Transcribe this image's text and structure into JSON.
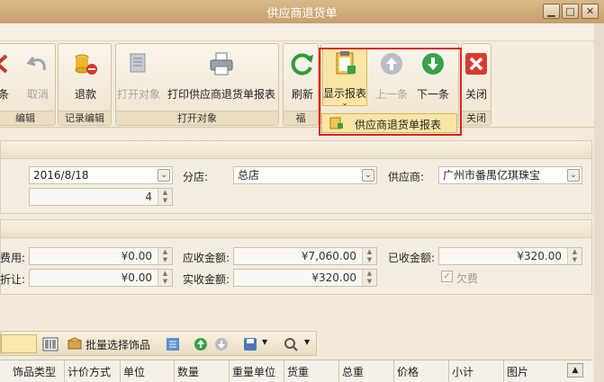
{
  "window": {
    "title": "供应商退货单"
  },
  "ribbon": {
    "buttons": {
      "delete_partial": "条",
      "cancel": "取消",
      "refund": "退款",
      "open_object": "打开对象",
      "print_report": "打印供应商退货单报表",
      "refresh": "刷新",
      "show_report": "显示报表",
      "prev": "上一条",
      "next": "下一条",
      "close": "关闭"
    },
    "groups": {
      "edit": "编辑",
      "record_edit": "记录编辑",
      "open_object": "打开对象",
      "partial": "福",
      "close": "关闭"
    },
    "dropdown_item": "供应商退货单报表"
  },
  "form": {
    "date": "2016/8/18",
    "spin_value": "4",
    "branch_label": "分店:",
    "branch_value": "总店",
    "supplier_label": "供应商:",
    "supplier_value": "广州市番禺亿琪珠宝",
    "fee_label": "费用:",
    "fee_value": "¥0.00",
    "receivable_label": "应收金额:",
    "receivable_value": "¥7,060.00",
    "received_label": "已收金额:",
    "received_value": "¥320.00",
    "discount_label": "折让:",
    "discount_value": "¥0.00",
    "actual_label": "实收金额:",
    "actual_value": "¥320.00",
    "owed_label": "欠费"
  },
  "toolbar2": {
    "batch_select": "批量选择饰品"
  },
  "grid": {
    "columns": [
      "饰品类型",
      "计价方式",
      "单位",
      "数量",
      "重量单位",
      "货重",
      "总重",
      "价格",
      "小计",
      "图片"
    ]
  }
}
